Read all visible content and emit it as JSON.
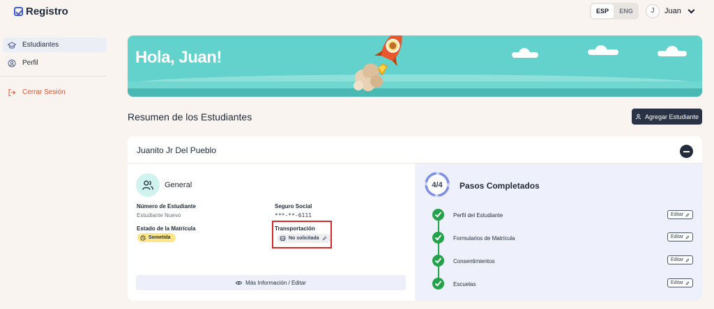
{
  "app": {
    "name": "Registro"
  },
  "language": {
    "options": [
      "ESP",
      "ENG"
    ],
    "selected": "ESP"
  },
  "user": {
    "initial": "J",
    "name": "Juan"
  },
  "sidebar": {
    "items": [
      {
        "label": "Estudiantes",
        "icon": "graduation-cap-icon",
        "active": true
      },
      {
        "label": "Perfil",
        "icon": "user-circle-icon",
        "active": false
      }
    ],
    "logout": {
      "label": "Cerrar Sesión",
      "icon": "logout-icon"
    }
  },
  "banner": {
    "greeting": "Hola, Juan!"
  },
  "summary": {
    "title": "Resumen de los Estudiantes",
    "add_button": "Agregar Estudiante"
  },
  "student": {
    "name": "Juanito Jr Del Pueblo",
    "general": {
      "title": "General",
      "student_number_label": "Número de Estudiante",
      "student_number_value": "Estudiante Nuevo",
      "ssn_label": "Seguro Social",
      "ssn_value": "***-**-6111",
      "enrollment_label": "Estado de la Matrícula",
      "enrollment_value": "Sometida",
      "transport_label": "Transportación",
      "transport_value": "No solicitada",
      "more_button": "Más Información / Editar"
    },
    "steps": {
      "progress": "4/4",
      "completed": 4,
      "total": 4,
      "title": "Pasos Completados",
      "edit_label": "Editar",
      "items": [
        {
          "label": "Perfil del Estudiante"
        },
        {
          "label": "Formularios de Matrícula"
        },
        {
          "label": "Consentimientos"
        },
        {
          "label": "Escuelas"
        }
      ]
    }
  },
  "colors": {
    "accent": "#2a3346",
    "banner": "#63d1cc",
    "success": "#22a34a",
    "logout": "#e5502e",
    "highlight": "#d62828"
  }
}
